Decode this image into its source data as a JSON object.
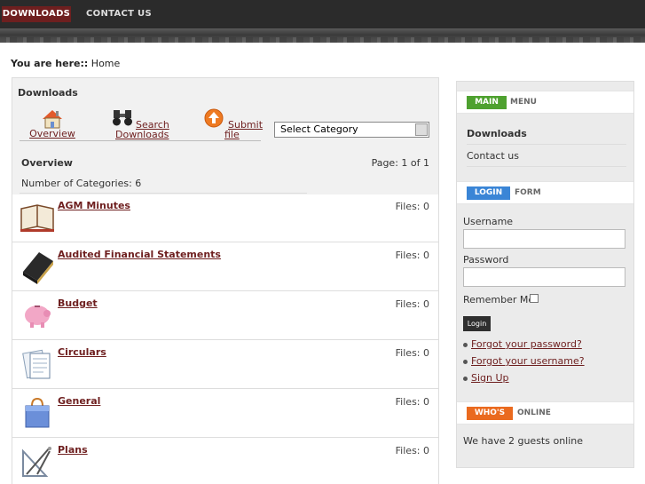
{
  "nav": {
    "items": [
      {
        "label": "DOWNLOADS"
      },
      {
        "label": "CONTACT US"
      }
    ]
  },
  "breadcrumb": {
    "prefix": "You are here::",
    "current": "Home"
  },
  "downloads": {
    "title": "Downloads",
    "tools": [
      {
        "label1": "Overview",
        "label2": "",
        "icon": "home-icon"
      },
      {
        "label1": "Search",
        "label2": "Downloads",
        "icon": "binoculars-icon"
      },
      {
        "label1": "Submit",
        "label2": "file",
        "icon": "upload-icon"
      }
    ],
    "select": {
      "value": "Select Category"
    },
    "overview_label": "Overview",
    "page_info": "Page: 1 of 1",
    "category_count": "Number of Categories: 6",
    "categories": [
      {
        "name": "AGM Minutes",
        "files": "Files: 0",
        "icon": "book-icon"
      },
      {
        "name": "Audited Financial Statements",
        "files": "Files: 0",
        "icon": "ledger-icon"
      },
      {
        "name": "Budget",
        "files": "Files: 0",
        "icon": "piggy-bank-icon"
      },
      {
        "name": "Circulars",
        "files": "Files: 0",
        "icon": "documents-icon"
      },
      {
        "name": "General",
        "files": "Files: 0",
        "icon": "shopping-bag-icon"
      },
      {
        "name": "Plans",
        "files": "Files: 0",
        "icon": "drafting-tools-icon"
      }
    ]
  },
  "sidebar": {
    "main_menu": {
      "badge": "MAIN",
      "word": "MENU",
      "items": [
        {
          "label": "Downloads"
        },
        {
          "label": "Contact us"
        }
      ]
    },
    "login": {
      "badge": "LOGIN",
      "word": "FORM",
      "username_label": "Username",
      "password_label": "Password",
      "remember_label": "Remember Me",
      "button": "Login",
      "links": [
        {
          "label": "Forgot your password?"
        },
        {
          "label": "Forgot your username?"
        },
        {
          "label": "Sign Up"
        }
      ]
    },
    "whos_online": {
      "badge": "WHO'S",
      "word": "ONLINE",
      "text": "We have 2 guests online"
    }
  },
  "colors": {
    "accent": "#6e1f1f",
    "green": "#4ea12f",
    "blue": "#3a85d6",
    "orange": "#ea6a1f",
    "topbar": "#2b2b2b"
  }
}
